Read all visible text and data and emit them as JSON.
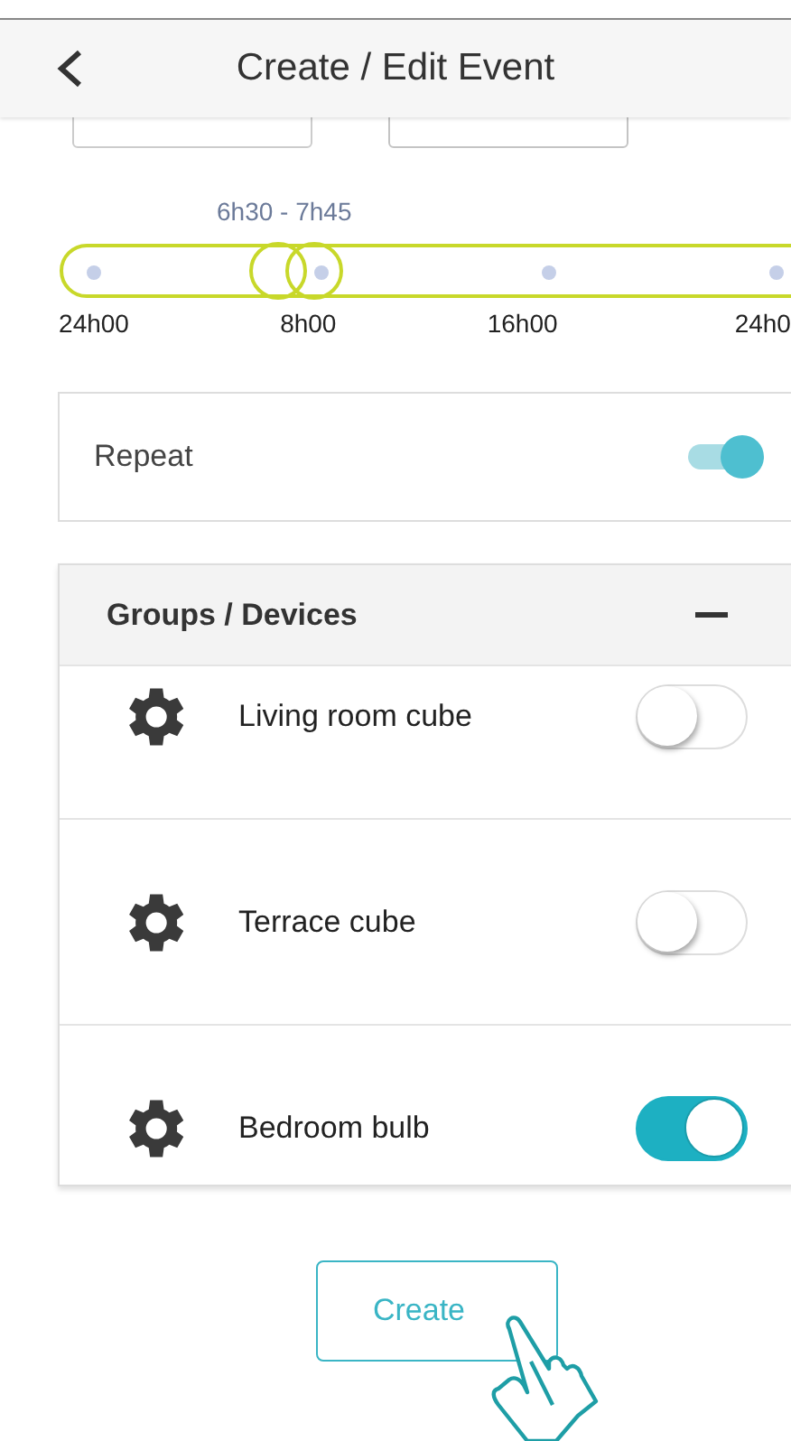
{
  "header": {
    "title": "Create / Edit Event"
  },
  "time_fields": [
    {
      "kind": "start"
    },
    {
      "kind": "end"
    }
  ],
  "range_slider": {
    "range_label": "6h30 - 7h45",
    "thumbs": [
      {
        "level": 0.271
      },
      {
        "level": 0.323
      }
    ],
    "tick_labels": [
      "24h00",
      "8h00",
      "16h00",
      "24h0"
    ]
  },
  "repeat": {
    "label": "Repeat",
    "on": true
  },
  "groups": {
    "title": "Groups / Devices",
    "expanded": true,
    "devices": [
      {
        "name": "Living room cube",
        "on": false
      },
      {
        "name": "Terrace cube",
        "on": false
      },
      {
        "name": "Bedroom bulb",
        "on": true
      }
    ]
  },
  "create_button": {
    "label": "Create"
  }
}
